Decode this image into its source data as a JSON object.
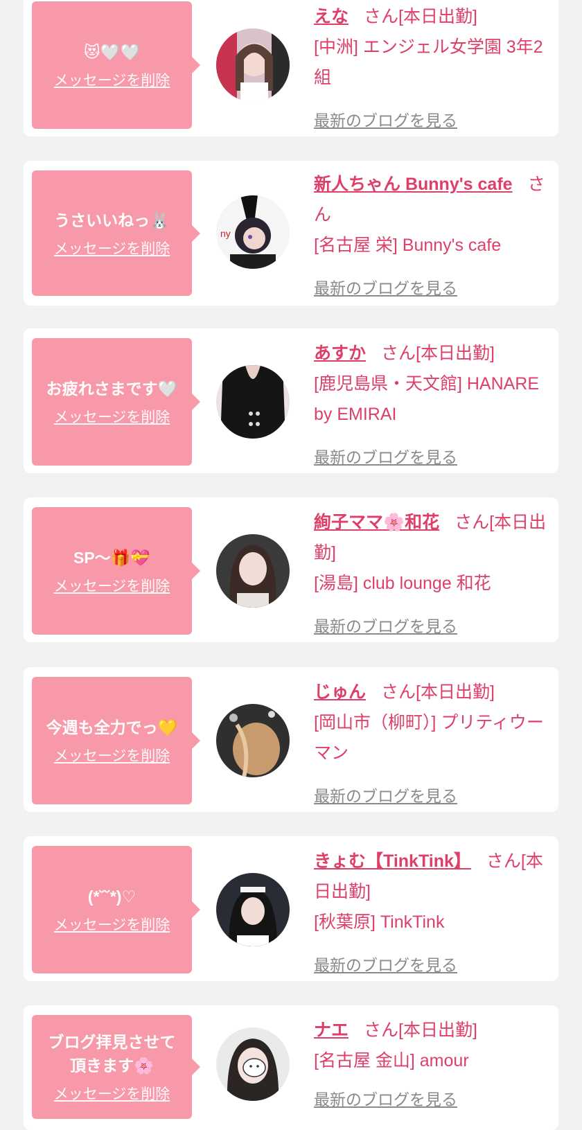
{
  "delete_label": "メッセージを削除",
  "blog_label": "最新のブログを見る",
  "entries": [
    {
      "message": "😻🤍🤍",
      "name": "えな",
      "suffix": "さん[本日出勤]",
      "shop": "[中洲] エンジェル女学園 3年2組"
    },
    {
      "message": "うさいいねっ🐰",
      "name": "新人ちゃん Bunny's cafe",
      "suffix": "さん",
      "shop": "[名古屋 栄] Bunny's cafe"
    },
    {
      "message": "お疲れさまです🤍",
      "name": "あすか",
      "suffix": "さん[本日出勤]",
      "shop": "[鹿児島県・天文館] HANARE by EMIRAI"
    },
    {
      "message": "SP〜🎁💝",
      "name": "絢子ママ🌸和花",
      "suffix": "さん[本日出勤]",
      "shop": "[湯島] club lounge 和花"
    },
    {
      "message": "今週も全力でっ💛",
      "name": "じゅん",
      "suffix": "さん[本日出勤]",
      "shop": "[岡山市（柳町）] プリティウーマン"
    },
    {
      "message": "(*˘˘*)♡",
      "name": "きょむ【TinkTink】",
      "suffix": "さん[本日出勤]",
      "shop": "[秋葉原] TinkTink"
    },
    {
      "message": "ブログ拝見させて頂きます🌸",
      "name": "ナエ",
      "suffix": "さん[本日出勤]",
      "shop": "[名古屋 金山] amour"
    }
  ]
}
